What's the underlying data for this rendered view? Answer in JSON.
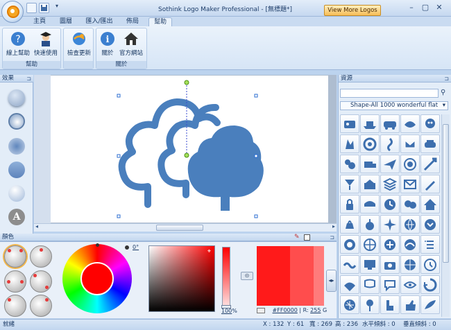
{
  "window": {
    "title": "Sothink Logo Maker Professional - [無標題*]",
    "promo_button": "View More Logos"
  },
  "tabs": [
    "主頁",
    "圖層",
    "匯入/匯出",
    "佈局",
    "幫助"
  ],
  "ribbon": {
    "groups": [
      {
        "label": "幫助",
        "buttons": [
          "線上幫助",
          "快速使用"
        ]
      },
      {
        "label": "",
        "buttons": [
          "檢查更新"
        ]
      },
      {
        "label": "關於",
        "buttons": [
          "關於",
          "官方網站"
        ]
      }
    ]
  },
  "effects_panel": {
    "title": "效果"
  },
  "color_panel": {
    "title": "顏色",
    "angle": "0°",
    "opacity": "100",
    "opacity_unit": "%",
    "hex_value": "#FF0000",
    "r_label": "R:",
    "r_value": "255",
    "r_extra": "G"
  },
  "resources_panel": {
    "title": "資源",
    "search_placeholder": "",
    "category": "Shape-All 1000 wonderful flat"
  },
  "status": {
    "ready": "就緒",
    "x": "X : 132",
    "y": "Y : 61",
    "width": "寬 : 269",
    "height": "高 : 236",
    "h_skew": "水平傾斜 : 0",
    "v_skew": "垂直傾斜 : 0"
  },
  "colors": {
    "logo_blue": "#4a7fbd",
    "selected_color": "#FF0000",
    "icon_blue": "#3d6fae"
  }
}
